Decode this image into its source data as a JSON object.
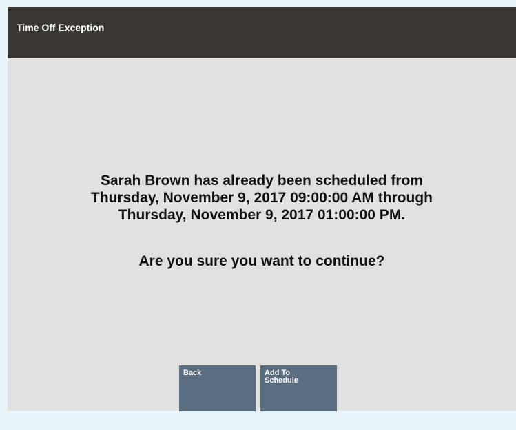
{
  "dialog": {
    "title": "Time Off Exception",
    "message_lines": [
      "Sarah Brown has already been scheduled from",
      "Thursday, November 9, 2017 09:00:00 AM through",
      "Thursday, November 9, 2017 01:00:00 PM."
    ],
    "question": "Are you sure you want to continue?"
  },
  "buttons": {
    "back_label": "Back",
    "add_to_schedule_label": "Add To Schedule"
  },
  "colors": {
    "page_background": "#e8f3fa",
    "dialog_background": "#e1e1e1",
    "title_bar": "#3a3733",
    "button": "#5a6e80"
  }
}
